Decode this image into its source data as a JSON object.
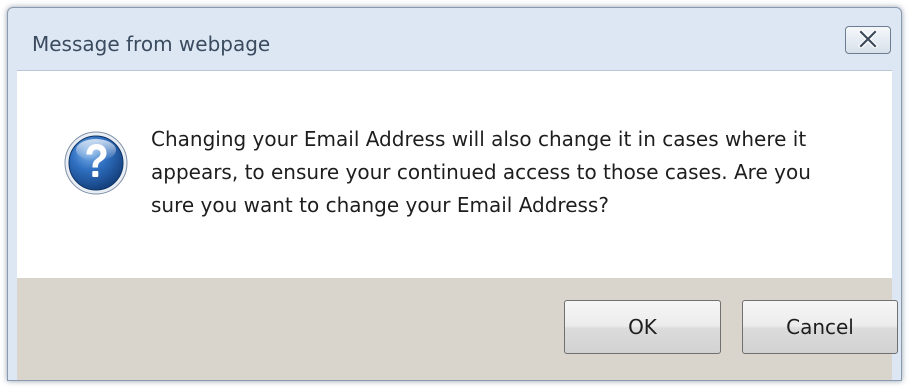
{
  "dialog": {
    "title": "Message from webpage",
    "message": "Changing your Email Address will also change it in cases where it appears, to ensure your continued access to those cases. Are you sure you want to change your Email Address?",
    "icon": "question-icon",
    "close_icon": "close-icon",
    "buttons": {
      "ok_label": "OK",
      "cancel_label": "Cancel"
    }
  },
  "colors": {
    "frame": "#dce7f3",
    "button_bar": "#d9d4cc",
    "icon_blue": "#1f5ea8"
  }
}
